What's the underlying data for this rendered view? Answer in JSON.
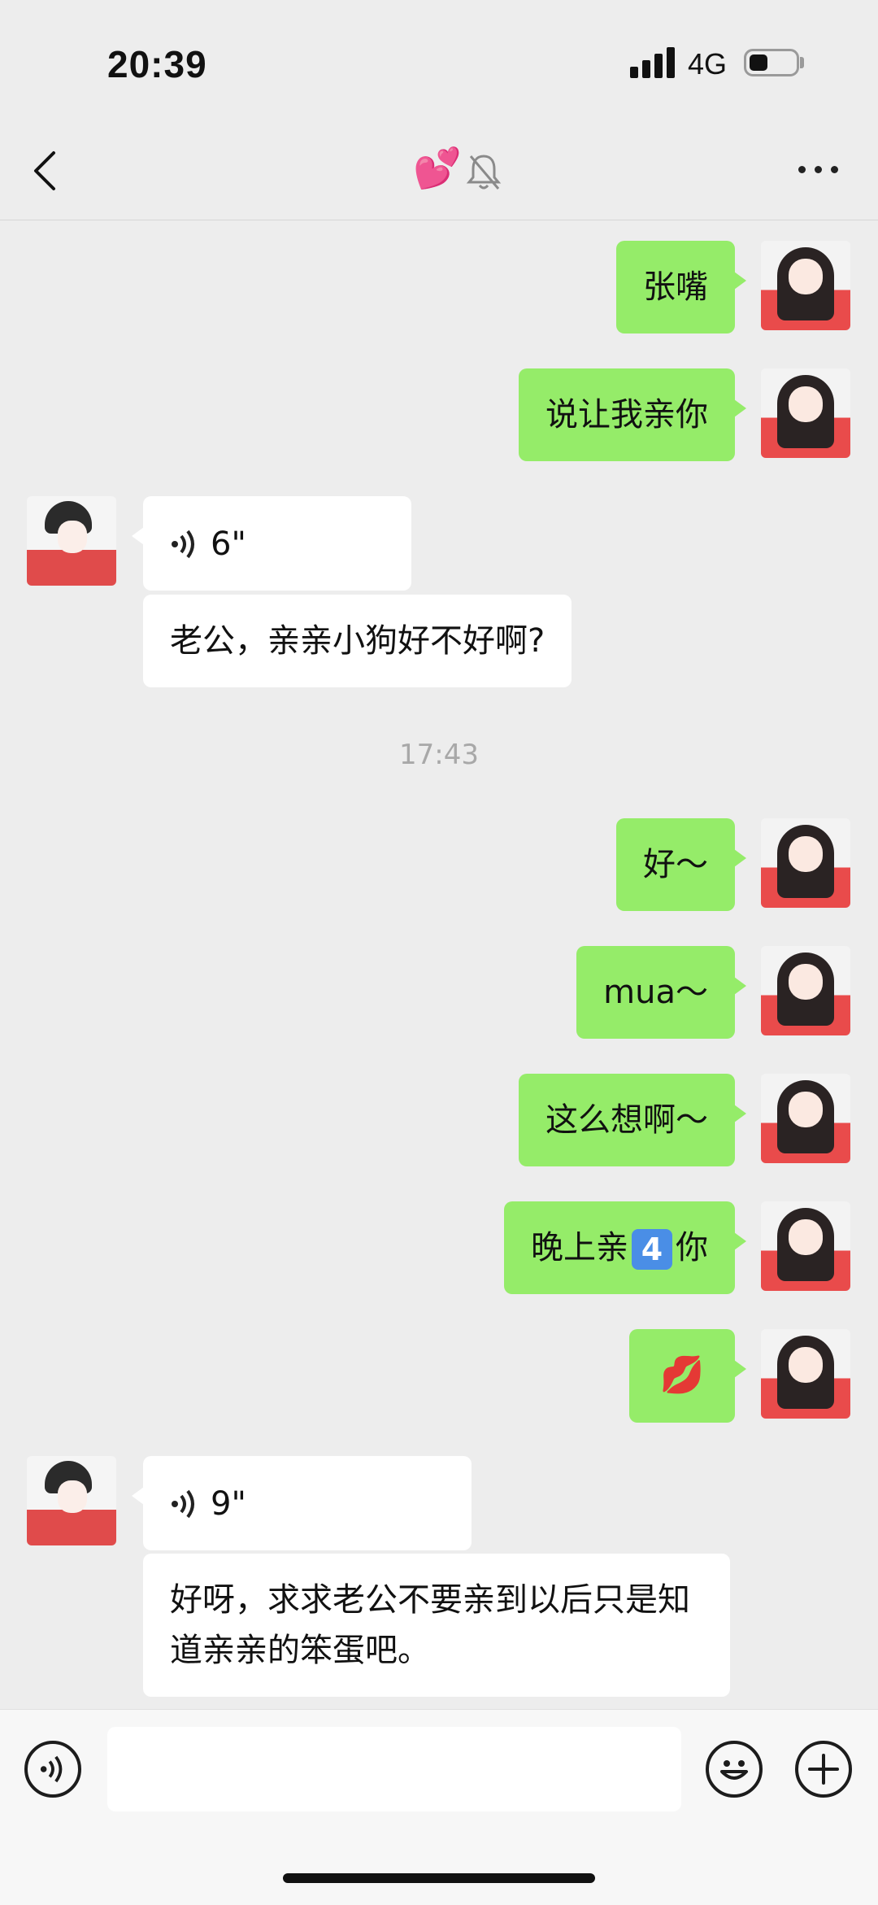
{
  "status_bar": {
    "time": "20:39",
    "network": "4G"
  },
  "header": {
    "title": "💕",
    "more_icon": "more-horizontal-icon",
    "mute_icon": "bell-off-icon"
  },
  "messages": [
    {
      "dir": "out",
      "type": "text",
      "text": "张嘴"
    },
    {
      "dir": "out",
      "type": "text",
      "text": "说让我亲你"
    },
    {
      "dir": "in",
      "type": "voice",
      "duration": "6\""
    },
    {
      "dir": "in",
      "type": "text",
      "text": "老公，亲亲小狗好不好啊?"
    },
    {
      "type": "time",
      "text": "17:43"
    },
    {
      "dir": "out",
      "type": "text",
      "text": "好～"
    },
    {
      "dir": "out",
      "type": "text",
      "text": "mua～"
    },
    {
      "dir": "out",
      "type": "text",
      "text": "这么想啊～"
    },
    {
      "dir": "out",
      "type": "text",
      "text_before": "晚上亲",
      "keycap": "4",
      "text_after": "你"
    },
    {
      "dir": "out",
      "type": "emoji",
      "text": "💋"
    },
    {
      "dir": "in",
      "type": "voice",
      "duration": "9\""
    },
    {
      "dir": "in",
      "type": "text",
      "text": "好呀，求求老公不要亲到以后只是知道亲亲的笨蛋吧。"
    }
  ],
  "input": {
    "value": ""
  }
}
